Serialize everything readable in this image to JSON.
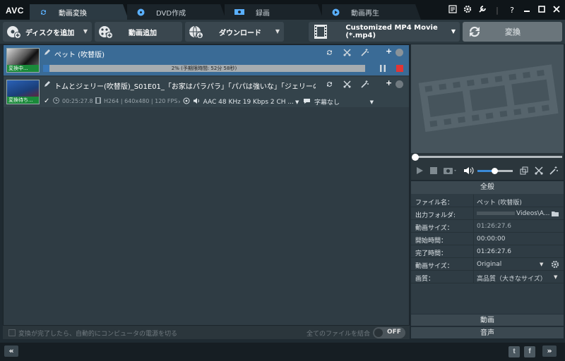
{
  "app": {
    "logo": "AVC"
  },
  "tabs": [
    {
      "label": "動画変換",
      "active": true
    },
    {
      "label": "DVD作成",
      "active": false
    },
    {
      "label": "録画",
      "active": false
    },
    {
      "label": "動画再生",
      "active": false
    }
  ],
  "window_controls": {
    "help": "?"
  },
  "toolbar": {
    "add_disc": "ディスクを追加",
    "add_video": "動画追加",
    "download": "ダウンロード",
    "format": "Customized MP4 Movie (*.mp4)",
    "convert": "変換"
  },
  "files": [
    {
      "name": "ペット (吹替版)",
      "status": "変換中...",
      "progress_text": "2% (予期限時間: 52分 58秒)",
      "progress": 2
    },
    {
      "name": "トムとジェリー(吹替版)_S01E01_「お家はパラパラ」「パパは強いな」「ジェリーの日記」「土曜の...",
      "status": "変換待ち...",
      "duration": "00:25:27.8",
      "codec_info": "H264 | 640x480 | 120 FPS",
      "audio": "AAC 48 KHz 19 Kbps 2 CH ...",
      "subtitle": "字幕なし"
    }
  ],
  "list_footer": {
    "shutdown_label": "変換が完了したら、自動的にコンピュータの電源を切る",
    "merge_label": "全てのファイルを結合",
    "toggle": "OFF"
  },
  "properties": {
    "header": "全般",
    "rows": [
      {
        "key": "ファイル名：",
        "value": "ペット (吹替版)"
      },
      {
        "key": "出力フォルダ:",
        "value": "Videos\\A..."
      },
      {
        "key": "動画サイズ：",
        "value": "01:26:27.6"
      },
      {
        "key": "開始時間：",
        "value": "00:00:00"
      },
      {
        "key": "完了時間：",
        "value": "01:26:27.6"
      },
      {
        "key": "動画サイズ：",
        "value": "Original"
      },
      {
        "key": "画質：",
        "value": "高品質（大きなサイズ）"
      }
    ],
    "section_video": "動画",
    "section_audio": "音声"
  },
  "footer": {
    "collapse": "«",
    "expand": "»",
    "twitter": "t",
    "facebook": "f"
  },
  "colors": {
    "accent_blue": "#3a6b96",
    "progress_fill": "#3a78b8",
    "stop_red": "#e23535"
  }
}
